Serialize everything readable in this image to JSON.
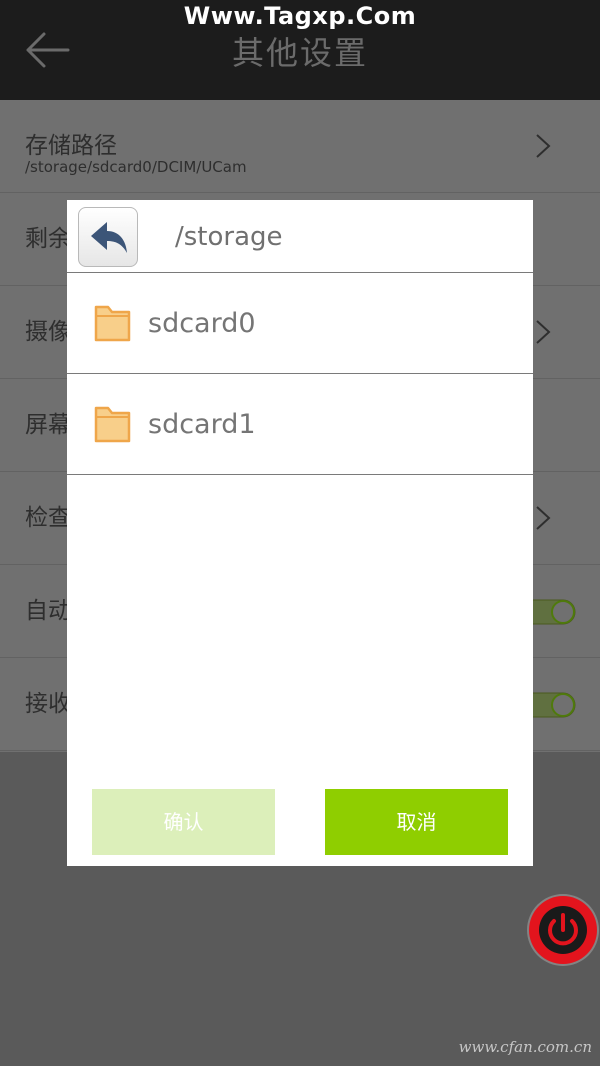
{
  "watermark_top": "Www.Tagxp.Com",
  "watermark_bottom": "www.cfan.com.cn",
  "header": {
    "title": "其他设置",
    "back_icon": "arrow-left-icon"
  },
  "settings": {
    "storage_path_label": "存储路径",
    "storage_path_value": "/storage/sdcard0/DCIM/UCam",
    "row2_label": "剩余",
    "row3_label": "摄像",
    "row4_label": "屏幕",
    "row5_label": "检查",
    "row6_label": "自动",
    "row7_label": "接收",
    "chevron_icon": "chevron-right-icon",
    "toggle_icon": "toggle-switch-icon"
  },
  "dialog": {
    "current_path": "/storage",
    "back_icon": "reply-arrow-icon",
    "folders": [
      {
        "name": "sdcard0",
        "icon": "folder-icon"
      },
      {
        "name": "sdcard1",
        "icon": "folder-icon"
      }
    ],
    "confirm_label": "确认",
    "cancel_label": "取消"
  },
  "power_icon": "power-icon",
  "colors": {
    "accent_green": "#8fce00",
    "confirm_disabled": "#dcefba",
    "power_red": "#e3141d",
    "folder_orange": "#f4b45a"
  }
}
